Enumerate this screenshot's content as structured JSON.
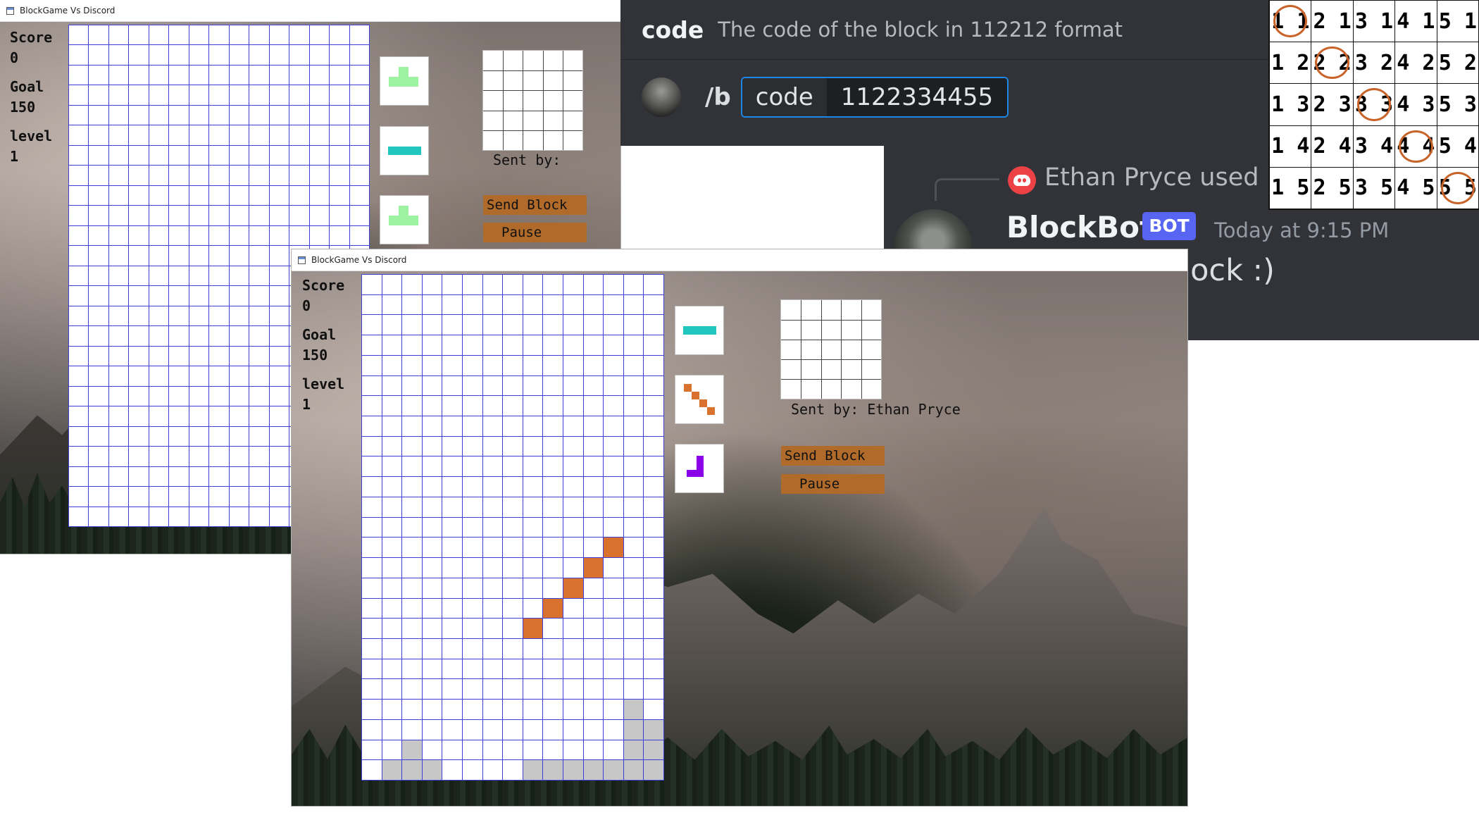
{
  "window1": {
    "title": "BlockGame Vs Discord",
    "score_label": "Score",
    "score": "0",
    "goal_label": "Goal",
    "goal": "150",
    "level_label": "level",
    "level": "1",
    "sent_by": "Sent by:",
    "send_label": "Send Block",
    "pause_label": "Pause",
    "next_pieces": [
      "green-t-piece",
      "cyan-i-piece",
      "green-t-piece"
    ]
  },
  "window2": {
    "title": "BlockGame Vs Discord",
    "score_label": "Score",
    "score": "0",
    "goal_label": "Goal",
    "goal": "150",
    "level_label": "level",
    "level": "1",
    "sent_by": "Sent by: Ethan Pryce",
    "send_label": "Send Block",
    "pause_label": "Pause",
    "next_pieces": [
      "cyan-i-piece",
      "orange-diagonal-piece",
      "purple-j-piece"
    ]
  },
  "discord": {
    "command": {
      "name": "code",
      "description": "The code of the block in 112212 format",
      "slash": "/b",
      "option_name": "code",
      "option_value": "1122334455"
    },
    "message": {
      "reply_user": "Ethan Pryce used",
      "bot_name": "BlockBot",
      "bot_tag": "BOT",
      "timestamp": "Today at 9:15 PM",
      "text": "Sent your block :)"
    }
  },
  "code_table": {
    "rows": [
      [
        "1 1",
        "2 1",
        "3 1",
        "4 1",
        "5 1"
      ],
      [
        "1 2",
        "2 2",
        "3 2",
        "4 2",
        "5 2"
      ],
      [
        "1 3",
        "2 3",
        "3 3",
        "4 3",
        "5 3"
      ],
      [
        "1 4",
        "2 4",
        "3 4",
        "4 4",
        "5 4"
      ],
      [
        "1 5",
        "2 5",
        "3 5",
        "4 5",
        "5 5"
      ]
    ],
    "circled": [
      "1 1",
      "2 2",
      "3 3",
      "4 4",
      "5 5"
    ]
  },
  "colors": {
    "grid_line": "#3d3fd6",
    "placed_block": "#d9712f",
    "button": "#b06a2a",
    "circle": "#c8642a",
    "bot_tag": "#5865f2"
  }
}
